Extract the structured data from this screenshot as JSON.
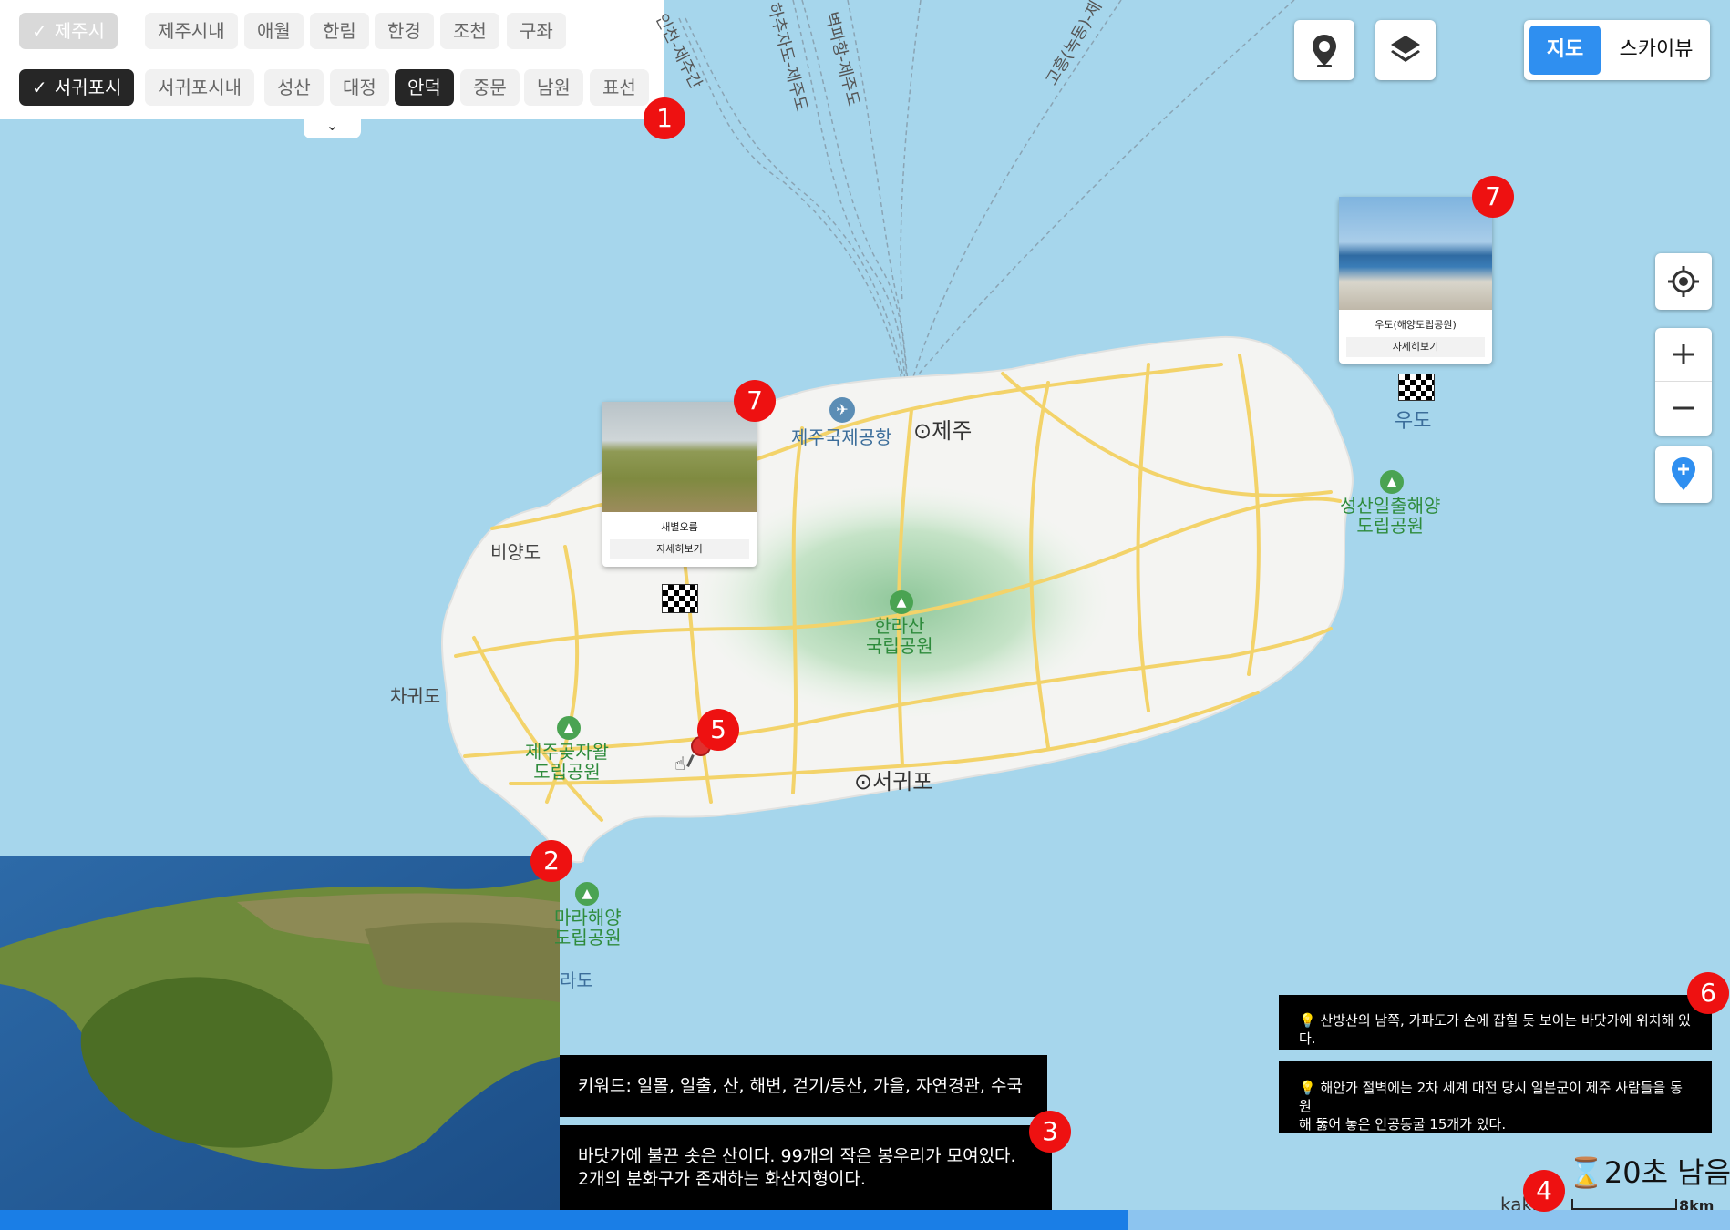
{
  "filters": {
    "row1": [
      {
        "label": "제주시",
        "state": "disabled",
        "checked": true
      },
      {
        "label": "제주시내",
        "state": "default"
      },
      {
        "label": "애월",
        "state": "default"
      },
      {
        "label": "한림",
        "state": "default"
      },
      {
        "label": "한경",
        "state": "default"
      },
      {
        "label": "조천",
        "state": "default"
      },
      {
        "label": "구좌",
        "state": "default"
      }
    ],
    "row2": [
      {
        "label": "서귀포시",
        "state": "selected",
        "checked": true
      },
      {
        "label": "서귀포시내",
        "state": "default"
      },
      {
        "label": "성산",
        "state": "default"
      },
      {
        "label": "대정",
        "state": "default"
      },
      {
        "label": "안덕",
        "state": "selected"
      },
      {
        "label": "중문",
        "state": "default"
      },
      {
        "label": "남원",
        "state": "default"
      },
      {
        "label": "표선",
        "state": "default"
      }
    ],
    "check_glyph": "✓",
    "expand_glyph": "⌄"
  },
  "map_type": {
    "map": "지도",
    "skyview": "스카이뷰",
    "active": "map"
  },
  "map_labels": {
    "airport": "제주국제공항",
    "jeju": "제주",
    "seogwipo": "서귀포",
    "biyangdo": "비양도",
    "chagwido": "차귀도",
    "udo": "우도",
    "hallasan": [
      "한라산",
      "국립공원"
    ],
    "seongsan": [
      "성산일출해양",
      "도립공원"
    ],
    "gotjawal": [
      "제주곶자왈",
      "도립공원"
    ],
    "mara": [
      "마라해양",
      "도립공원"
    ],
    "marado_partial": "라도",
    "ferry_routes": [
      "인천-제주간",
      "하추자도-제주도",
      "벽파항-제주도",
      "고흥(녹동)-제"
    ]
  },
  "cards": [
    {
      "name": "새별오름",
      "button": "자세히보기"
    },
    {
      "name": "우도(해양도립공원)",
      "button": "자세히보기"
    }
  ],
  "keywords": "키워드: 일몰, 일출, 산, 해변, 걷기/등산, 가을, 자연경관, 수국",
  "description": [
    "바닷가에 불끈 솟은 산이다. 99개의 작은 봉우리가 모여있다.",
    "2개의 분화구가 존재하는 화산지형이다."
  ],
  "hints": [
    "💡 산방산의 남쪽, 가파도가 손에 잡힐 듯 보이는 바닷가에 위치해 있다.",
    [
      "💡 해안가 절벽에는 2차 세계 대전 당시 일본군이 제주 사람들을 동원",
      "해 뚫어 놓은 인공동굴 15개가 있다."
    ]
  ],
  "timer": "⌛20초 남음",
  "scale": {
    "logo": "kakao",
    "distance": "8km"
  },
  "badges": [
    "1",
    "2",
    "3",
    "4",
    "5",
    "6",
    "7",
    "7"
  ],
  "progress": {
    "fraction": 0.652
  },
  "icons": {
    "marker_button": "map-pin-icon",
    "layers_button": "layers-icon",
    "locate_button": "crosshair-icon",
    "zoom_in": "plus-icon",
    "zoom_out": "minus-icon",
    "add_marker": "add-pin-icon"
  },
  "colors": {
    "accent": "#1a7ee6",
    "badge": "#ee1111",
    "map_water": "#a6d6ec",
    "park": "#2e8b3c"
  }
}
